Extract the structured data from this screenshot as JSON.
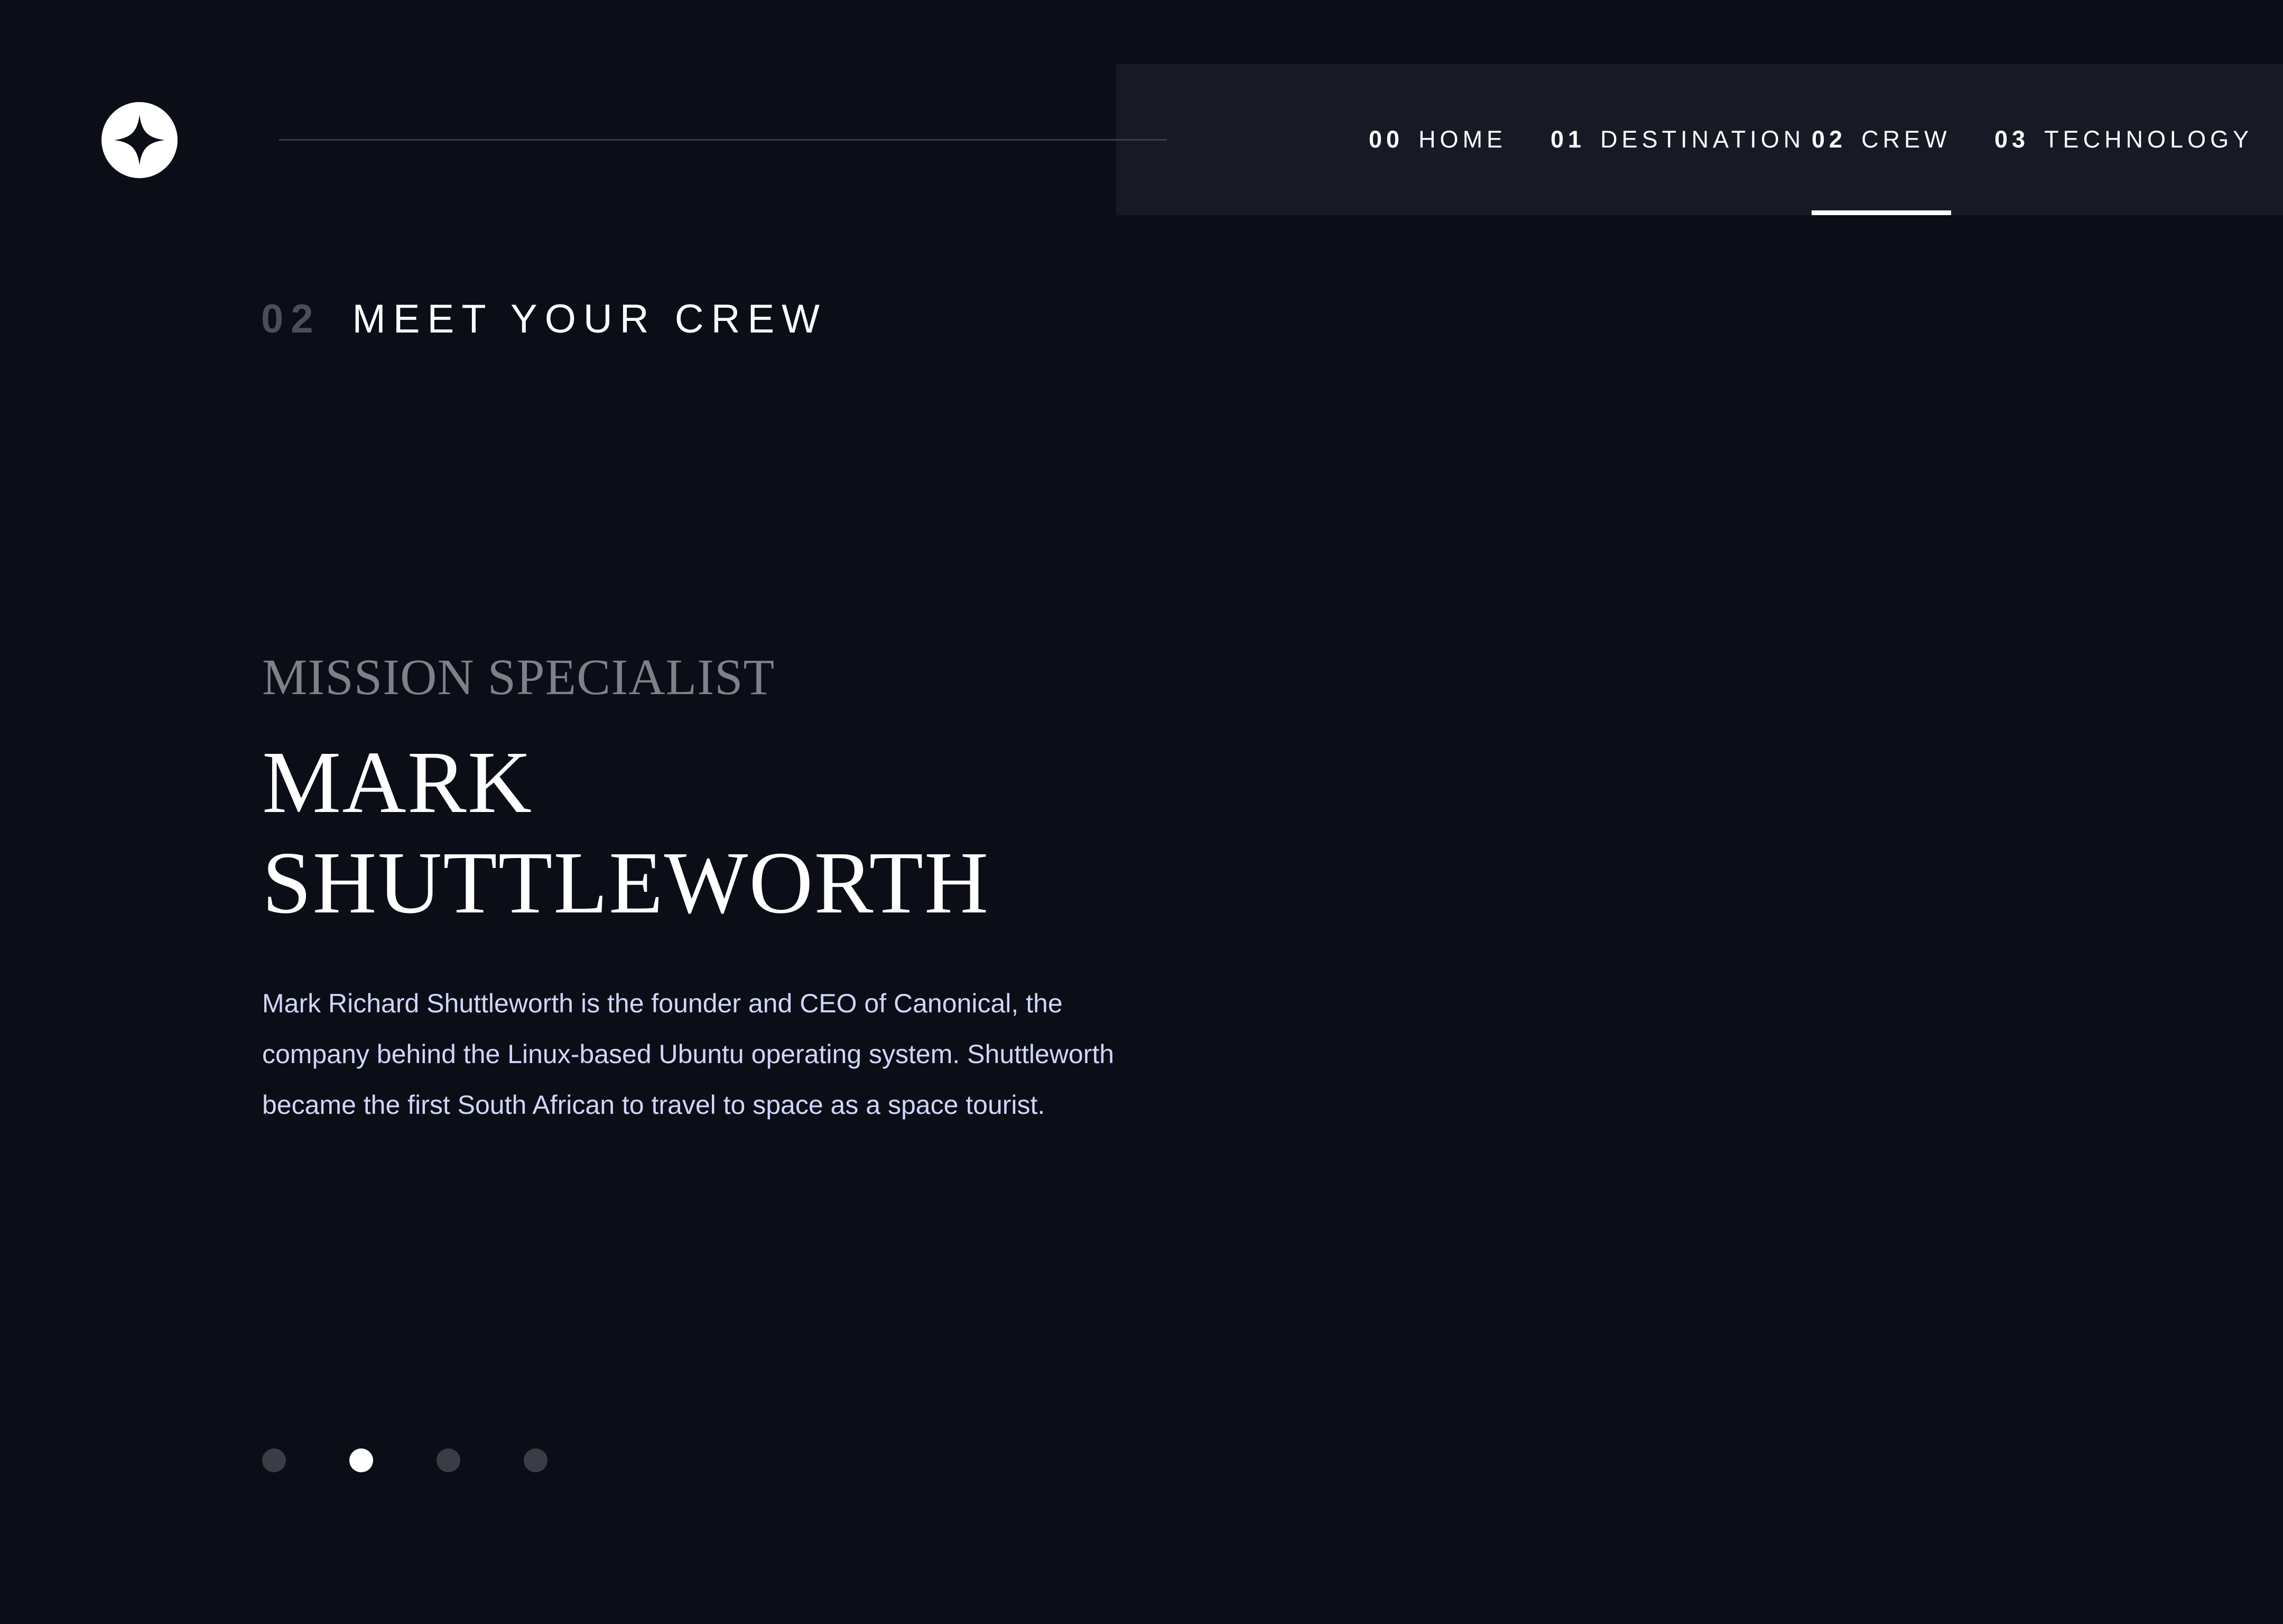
{
  "header": {
    "logo_icon": "star-logo-icon"
  },
  "nav": {
    "items": [
      {
        "num": "00",
        "label": "HOME",
        "active": false
      },
      {
        "num": "01",
        "label": "DESTINATION",
        "active": false
      },
      {
        "num": "02",
        "label": "CREW",
        "active": true
      },
      {
        "num": "03",
        "label": "TECHNOLOGY",
        "active": false
      }
    ]
  },
  "page": {
    "heading_num": "02",
    "heading_title": "MEET YOUR CREW"
  },
  "crew": {
    "role": "MISSION SPECIALIST",
    "name_line1": "MARK",
    "name_line2": "SHUTTLEWORTH",
    "bio": "Mark Richard Shuttleworth is the founder and CEO of Canonical, the company behind the Linux-based Ubuntu operating system. Shuttleworth became the first South African to travel to space as a space tourist."
  },
  "slider": {
    "count": 4,
    "active_index": 1
  },
  "colors": {
    "background": "#0b0d17",
    "nav_background": "#171a24",
    "accent_text": "#d0d6f9",
    "muted": "#7f8089",
    "inactive_dot": "#3b3d46"
  }
}
